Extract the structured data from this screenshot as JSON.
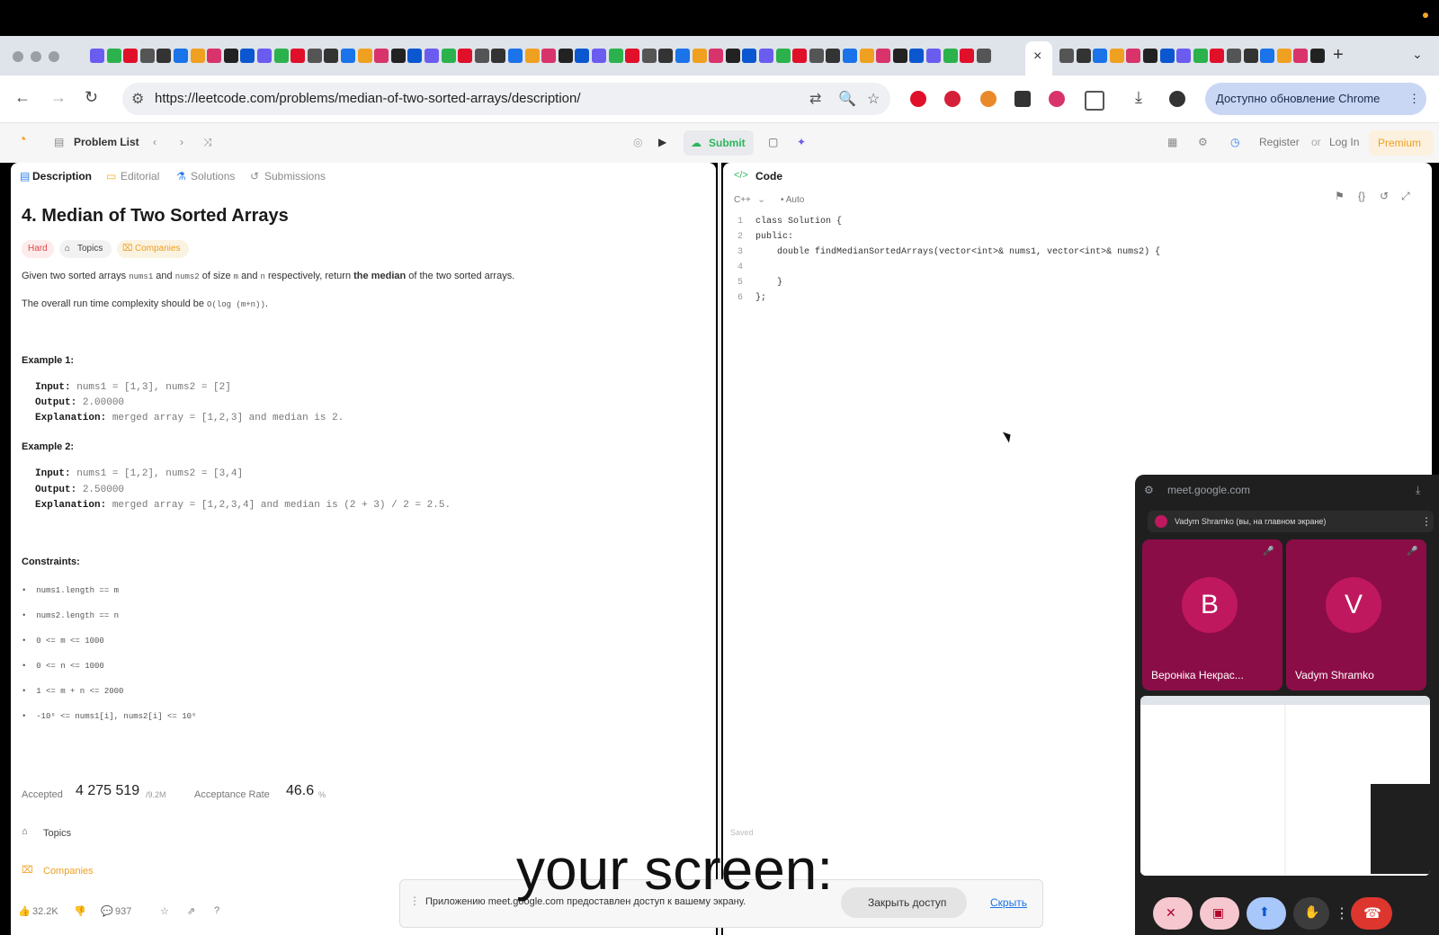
{
  "browser": {
    "url": "https://leetcode.com/problems/median-of-two-sorted-arrays/description/",
    "update_button": "Доступно обновление Chrome",
    "tab_close": "×",
    "new_tab": "+"
  },
  "lc_header": {
    "problem_list": "Problem List",
    "submit": "Submit",
    "register": "Register",
    "or": "or",
    "login": "Log In",
    "premium": "Premium"
  },
  "left": {
    "tabs": [
      "Description",
      "Editorial",
      "Solutions",
      "Submissions"
    ],
    "title": "4. Median of Two Sorted Arrays",
    "difficulty": "Hard",
    "topics_pill": "Topics",
    "companies_pill": "Companies",
    "statement": "Given two sorted arrays nums1 and nums2 of size m and n respectively, return the median of the two sorted arrays.",
    "statement_pre": "Given two sorted arrays ",
    "statement_a": "nums1",
    "statement_and": " and ",
    "statement_b": "nums2",
    "statement_size": " of size ",
    "statement_m": "m",
    "statement_and2": " and ",
    "statement_n": "n",
    "statement_resp": " respectively, return ",
    "statement_bold": "the median",
    "statement_post": " of the two sorted arrays.",
    "complexity_pre": "The overall run time complexity should be ",
    "complexity_code": "O(log (m+n))",
    "complexity_post": ".",
    "example1_title": "Example 1:",
    "example1": {
      "input_label": "Input:",
      "input": "nums1 = [1,3], nums2 = [2]",
      "output_label": "Output:",
      "output": "2.00000",
      "expl_label": "Explanation:",
      "expl": "merged array = [1,2,3] and median is 2."
    },
    "example2_title": "Example 2:",
    "example2": {
      "input_label": "Input:",
      "input": "nums1 = [1,2], nums2 = [3,4]",
      "output_label": "Output:",
      "output": "2.50000",
      "expl_label": "Explanation:",
      "expl": "merged array = [1,2,3,4] and median is (2 + 3) / 2 = 2.5."
    },
    "constraints_title": "Constraints:",
    "constraints": [
      "nums1.length == m",
      "nums2.length == n",
      "0 <= m <= 1000",
      "0 <= n <= 1000",
      "1 <= m + n <= 2000",
      "-10⁶ <= nums1[i], nums2[i] <= 10⁶"
    ],
    "accepted_label": "Accepted",
    "accepted_value": "4 275 519",
    "accepted_sub": "/9.2M",
    "rate_label": "Acceptance Rate",
    "rate_value": "46.6",
    "rate_unit": "%",
    "topics_row": "Topics",
    "companies_row": "Companies",
    "likes": "32.2K",
    "comments": "937"
  },
  "right": {
    "code_tab": "Code",
    "language": "C++",
    "auto": "Auto",
    "code_lines": [
      {
        "n": "1",
        "text": "class Solution {"
      },
      {
        "n": "2",
        "text": "public:"
      },
      {
        "n": "3",
        "text": "    double findMedianSortedArrays(vector<int>& nums1, vector<int>& nums2) {"
      },
      {
        "n": "4",
        "text": ""
      },
      {
        "n": "5",
        "text": "    }"
      },
      {
        "n": "6",
        "text": "};"
      }
    ],
    "saved": "Saved"
  },
  "meet": {
    "url": "meet.google.com",
    "host_label": "Vadym Shramko (вы, на главном экране)",
    "participants": [
      {
        "initial": "B",
        "name": "Вероніка Некрас..."
      },
      {
        "initial": "V",
        "name": "Vadym Shramko"
      }
    ]
  },
  "toast": {
    "message": "Приложению meet.google.com предоставлен доступ к вашему экрану.",
    "stop_button": "Закрыть доступ",
    "hide_link": "Скрыть"
  },
  "caption": "your screen:",
  "colors": {
    "accent_green": "#2db55d",
    "meet_tile": "#8b0d47",
    "premium": "#f0a020"
  }
}
